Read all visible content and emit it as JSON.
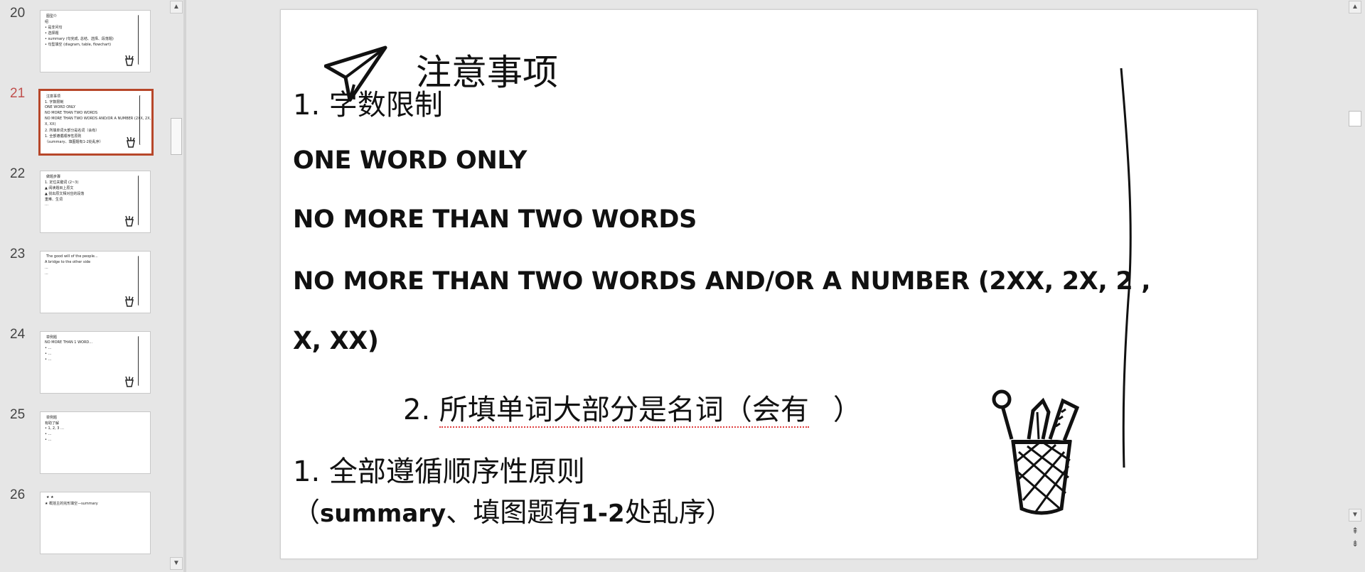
{
  "thumbnails": [
    {
      "number": "20",
      "lines": [
        "图型介",
        "绍",
        "• 是非问句",
        "• 选择题",
        "• summary (句完成, 总结、选择、段落题)",
        "• 句型填空 (diagram, table, flowchart)"
      ]
    },
    {
      "number": "21",
      "lines": [
        "注意事项",
        "1. 字数限制",
        "ONE WORD ONLY",
        "NO MORE THAN TWO WORDS",
        "NO MORE THAN TWO WORDS AND/OR A NUMBER (2XX, 2X, 2,",
        "X, XX)",
        "2. 所填单词大部分是名词（会有）",
        "1. 全部遵循顺序性原则",
        "（summary、填图题有1-2处乱序）"
      ]
    },
    {
      "number": "22",
      "lines": [
        "做题步骤",
        "1. 定位关键词 (2~3)",
        "▲ 阅读题目上原文",
        "▲ 找出原文相对应的段落",
        "重难、生词",
        "…"
      ]
    },
    {
      "number": "23",
      "lines": [
        "The good will of the people...",
        "A bridge to the other side",
        "...",
        "..."
      ]
    },
    {
      "number": "24",
      "lines": [
        "举例题",
        "NO MORE THAN 1 WORD...",
        "• …",
        "• …",
        "• …"
      ]
    },
    {
      "number": "25",
      "lines": [
        "举例题",
        "有助了解",
        "• 1, 2, 3 …",
        "• …",
        "• …"
      ]
    },
    {
      "number": "26",
      "lines": [
        "★   ★",
        "★ 概括主的完形填空—summary"
      ]
    }
  ],
  "active_slide": "21",
  "slide": {
    "title": "注意事项",
    "item1": "1.  字数限制",
    "rule1": "ONE WORD ONLY",
    "rule2": "NO MORE THAN TWO WORDS",
    "rule3a": "NO MORE THAN TWO WORDS AND/OR A NUMBER  (2XX, 2X, 2 ,",
    "rule3b": "X, XX)",
    "item2_num": "2. ",
    "item2_text": "所填单词大部分是名词（会有",
    "item2_end": "）",
    "item3": "1.  全部遵循顺序性原则",
    "note_open": "（",
    "note_a": "summary",
    "note_b": "、填图题有",
    "note_c": "1-2",
    "note_d": "处乱序）"
  },
  "icons": {
    "paper_plane": "paper-plane-icon",
    "pen_cup": "pencil-cup-icon"
  },
  "colors": {
    "active_border": "#b7472a",
    "active_number": "#c0504d",
    "spell_error": "#e04040"
  }
}
